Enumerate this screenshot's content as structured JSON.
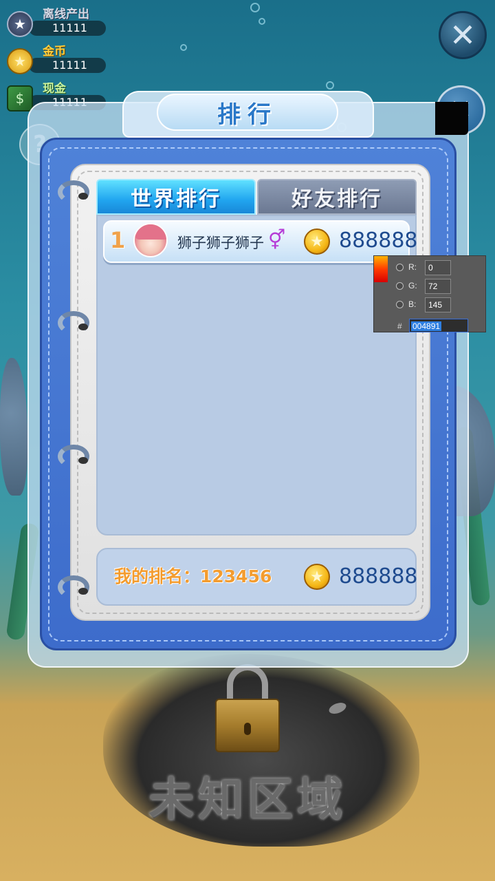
{
  "hud": {
    "offline_label": "离线产出",
    "offline_value": "11111",
    "gold_label": "金币",
    "gold_value": "11111",
    "cash_label": "现金",
    "cash_value": "11111",
    "star_icon": "★",
    "coin_icon": "★",
    "cash_icon": "$"
  },
  "dialog": {
    "title": "排行",
    "close_glyph": "✕",
    "tabs": [
      {
        "label": "世界排行",
        "active": true
      },
      {
        "label": "好友排行",
        "active": false
      }
    ],
    "ranking": [
      {
        "rank": "1",
        "name": "狮子狮子狮子",
        "gender_icon": "⚥",
        "score": "888888"
      }
    ],
    "my_rank_label": "我的排名：123456",
    "my_score": "888888"
  },
  "background": {
    "area_text": "未知区域",
    "help_glyph": "?"
  },
  "color_picker": {
    "r_label": "R:",
    "r_value": "0",
    "g_label": "G:",
    "g_value": "72",
    "b_label": "B:",
    "b_value": "145",
    "hash": "#",
    "hex": "004891"
  },
  "colors": {
    "panel_blue": "#3d6ccb",
    "tab_active": "#21a5ef",
    "score_text": "#1f4b8f",
    "rank_label": "#f39c2f"
  }
}
